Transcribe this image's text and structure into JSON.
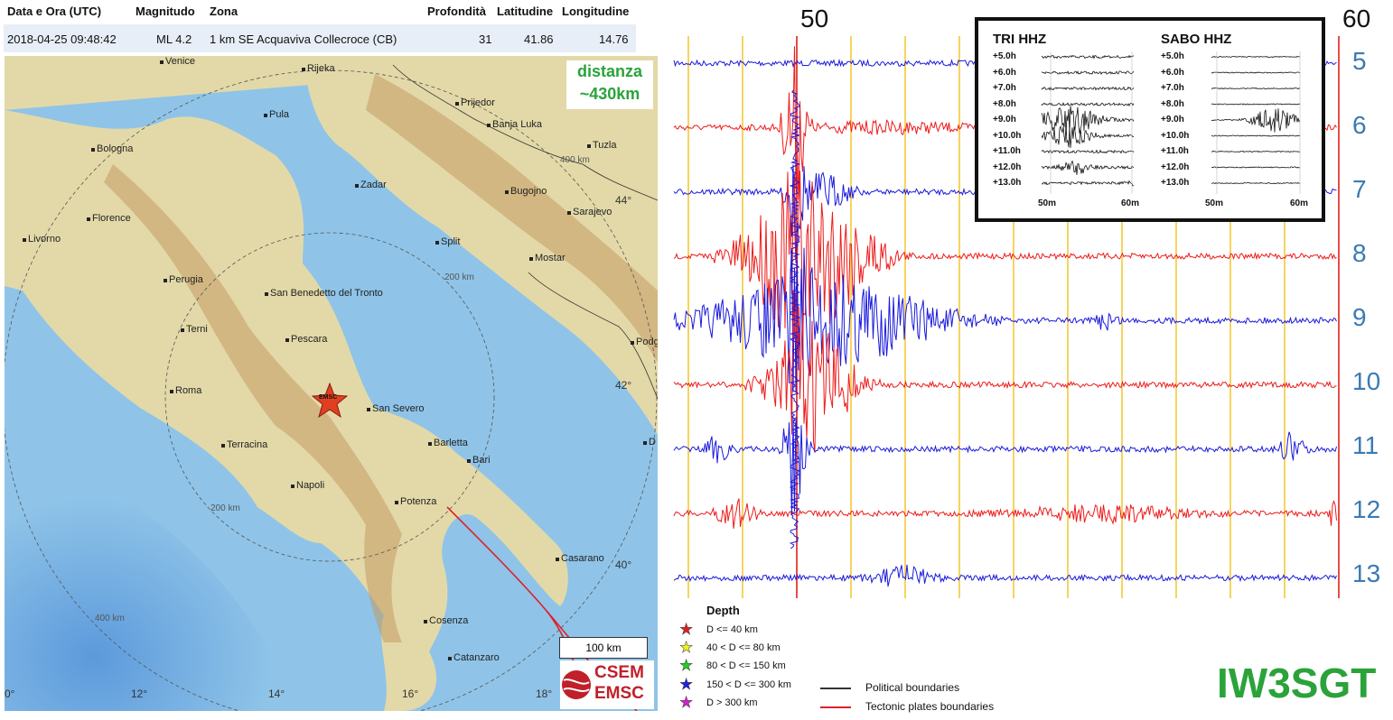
{
  "table": {
    "headers": [
      "Data e Ora (UTC)",
      "Magnitudo",
      "Zona",
      "Profondità",
      "Latitudine",
      "Longitudine"
    ],
    "row": {
      "datetime": "2018-04-25 09:48:42",
      "magnitude": "ML 4.2",
      "zone": "1 km SE Acquaviva Collecroce (CB)",
      "depth": "31",
      "latitude": "41.86",
      "longitude": "14.76"
    }
  },
  "map": {
    "distance_line1": "distanza",
    "distance_line2": "~430km",
    "epicenter_label": "EMSC",
    "scale_label": "100 km",
    "logo_line1": "CSEM",
    "logo_line2": "EMSC",
    "colors": {
      "sea": "#8fc4e8",
      "land": "#e3d9a8",
      "mountain": "#c49a62",
      "plate_boundary": "#e0202a",
      "epicenter": "#e04020"
    },
    "cities": [
      "Venice",
      "Rijeka",
      "Prijedor",
      "Pula",
      "Banja Luka",
      "Bologna",
      "Tuzla",
      "Zadar",
      "Bugojno",
      "Florence",
      "Sarajevo",
      "Livorno",
      "Split",
      "Mostar",
      "Perugia",
      "San Benedetto del Tronto",
      "Terni",
      "Pescara",
      "Roma",
      "San Severo",
      "Barletta",
      "Terracina",
      "Bari",
      "Napoli",
      "Potenza",
      "Casarano",
      "Cosenza",
      "Catanzaro",
      "Podg",
      "D"
    ],
    "ring_labels": [
      "400 km",
      "200 km",
      "200 km",
      "400 km"
    ],
    "lat_labels": [
      "44°",
      "42°",
      "40°"
    ],
    "lon_labels": [
      "0°",
      "12°",
      "14°",
      "16°",
      "18°"
    ]
  },
  "seismogram": {
    "minute_labels": [
      "50",
      "60"
    ],
    "hour_rows": [
      "5",
      "6",
      "7",
      "8",
      "9",
      "10",
      "11",
      "12",
      "13"
    ],
    "trace_colors": [
      "#1a1adc",
      "#ee1a1a"
    ],
    "grid_color": "#f2c21b",
    "inset": {
      "left_title": "TRI HHZ",
      "right_title": "SABO HHZ",
      "rows": [
        "+5.0h",
        "+6.0h",
        "+7.0h",
        "+8.0h",
        "+9.0h",
        "+10.0h",
        "+11.0h",
        "+12.0h",
        "+13.0h"
      ],
      "x_labels": [
        "50m",
        "60m"
      ]
    }
  },
  "legend": {
    "title": "Depth",
    "items": [
      {
        "label": "D <= 40 km",
        "color": "#e02020"
      },
      {
        "label": "40 < D <= 80 km",
        "color": "#f0f020"
      },
      {
        "label": "80 < D <= 150 km",
        "color": "#20d020"
      },
      {
        "label": "150 < D <= 300 km",
        "color": "#2020e0"
      },
      {
        "label": "D > 300 km",
        "color": "#d020d0"
      }
    ],
    "lines": [
      {
        "label": "Political boundaries",
        "color": "#333333"
      },
      {
        "label": "Tectonic plates boundaries",
        "color": "#e0202a"
      }
    ]
  },
  "callsign": "IW3SGT"
}
